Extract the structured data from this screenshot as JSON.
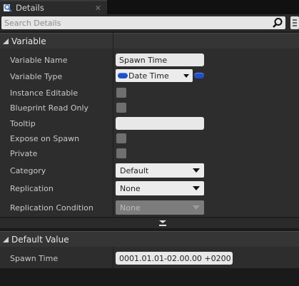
{
  "tab": {
    "title": "Details",
    "icon": "magnifier-details-icon"
  },
  "search": {
    "placeholder": "Search Details"
  },
  "sections": {
    "variable": {
      "title": "Variable",
      "rows": {
        "variable_name": {
          "label": "Variable Name",
          "value": "Spawn Time"
        },
        "variable_type": {
          "label": "Variable Type",
          "value": "Date Time",
          "pin_color": "#1f4fc9"
        },
        "instance_editable": {
          "label": "Instance Editable",
          "checked": false
        },
        "blueprint_read_only": {
          "label": "Blueprint Read Only",
          "checked": false
        },
        "tooltip": {
          "label": "Tooltip",
          "value": ""
        },
        "expose_on_spawn": {
          "label": "Expose on Spawn",
          "checked": false
        },
        "private": {
          "label": "Private",
          "checked": false
        },
        "category": {
          "label": "Category",
          "value": "Default"
        },
        "replication": {
          "label": "Replication",
          "value": "None"
        },
        "replication_condition": {
          "label": "Replication Condition",
          "value": "None",
          "disabled": true
        }
      }
    },
    "default_value": {
      "title": "Default Value",
      "rows": {
        "spawn_time": {
          "label": "Spawn Time",
          "value": "0001.01.01-02.00.00 +0200"
        }
      }
    }
  },
  "colors": {
    "panel": "#2d2d2d",
    "header": "#353535",
    "accent_blue": "#1f4fc9"
  }
}
